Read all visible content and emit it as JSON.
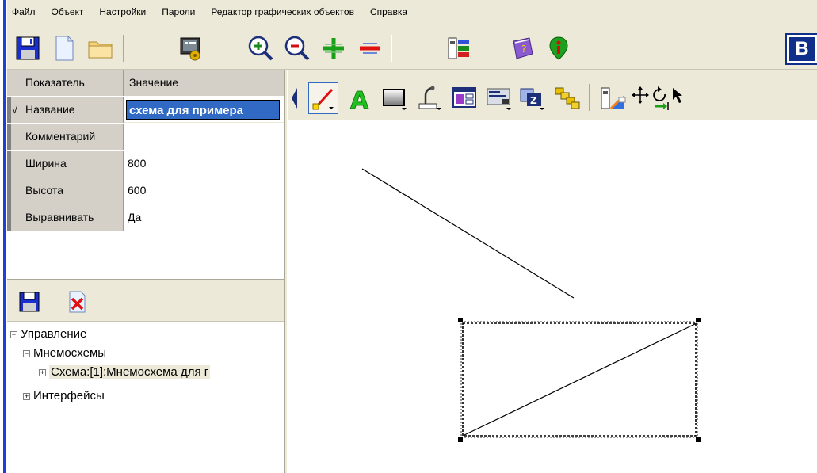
{
  "menu": [
    "Файл",
    "Объект",
    "Настройки",
    "Пароли",
    "Редактор графических объектов",
    "Справка"
  ],
  "toolbar": {
    "icons": [
      "save-icon",
      "new-document-icon",
      "open-folder-icon",
      "settings-screen-icon",
      "zoom-in-icon",
      "zoom-out-icon",
      "add-green-icon",
      "remove-red-icon",
      "tools-icon",
      "book-icon",
      "info-icon"
    ],
    "brand": "B"
  },
  "properties": {
    "header": {
      "name": "Показатель",
      "value": "Значение"
    },
    "rows": [
      {
        "name": "Название",
        "value": "схема для примера",
        "checked": "√"
      },
      {
        "name": "Комментарий",
        "value": ""
      },
      {
        "name": "Ширина",
        "value": "800"
      },
      {
        "name": "Высота",
        "value": "600"
      },
      {
        "name": "Выравнивать",
        "value": "Да"
      }
    ]
  },
  "tree": {
    "nodes": [
      {
        "label": "Управление",
        "expander": "−"
      },
      {
        "label": "Мнемосхемы",
        "expander": "−"
      },
      {
        "label": "Схема:[1]:Мнемосхема для г",
        "expander": "+"
      },
      {
        "label": "Интерфейсы",
        "expander": "+"
      }
    ]
  },
  "editor": {
    "tools": [
      "line-tool-icon",
      "text-tool-icon",
      "rectangle-tool-icon",
      "valve-tool-icon",
      "window-tool-icon",
      "panel-tool-icon",
      "layers-tool-icon",
      "group-tool-icon",
      "properties-tool-icon",
      "move-icon",
      "rotate-icon",
      "pointer-icon"
    ]
  },
  "colors": {
    "accent_blue": "#1f3fd6",
    "selection": "#316ac5",
    "panel": "#ece9d8"
  }
}
